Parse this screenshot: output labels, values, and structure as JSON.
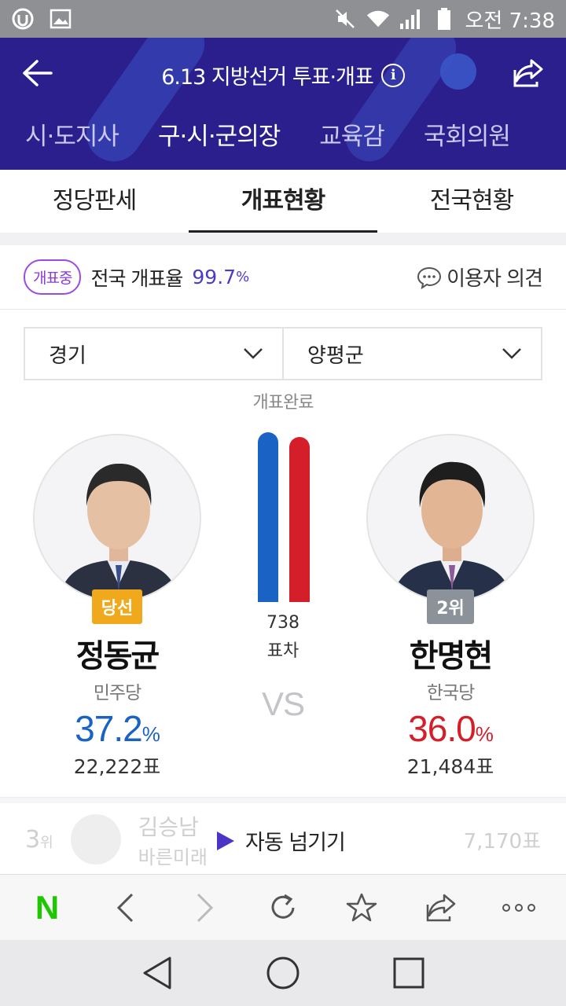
{
  "status_bar": {
    "time": "오전 7:38"
  },
  "header": {
    "title": "6.13 지방선거 투표·개표",
    "category_tabs": [
      {
        "label": "시·도지사",
        "active": false
      },
      {
        "label": "구·시·군의장",
        "active": true
      },
      {
        "label": "교육감",
        "active": false
      },
      {
        "label": "국회의원",
        "active": false
      }
    ]
  },
  "sub_tabs": [
    {
      "label": "정당판세",
      "active": false
    },
    {
      "label": "개표현황",
      "active": true
    },
    {
      "label": "전국현황",
      "active": false
    }
  ],
  "progress": {
    "badge": "개표중",
    "label": "전국 개표율",
    "value": "99.7",
    "unit": "%",
    "feedback_label": "이용자 의견"
  },
  "selectors": {
    "region": "경기",
    "district": "양평군"
  },
  "count_status": "개표완료",
  "candidates": [
    {
      "rank_label": "당선",
      "name": "정동균",
      "party": "민주당",
      "pct": "37.2",
      "pct_unit": "%",
      "votes": "22,222표",
      "color": "#1a63c4"
    },
    {
      "rank_label": "2위",
      "name": "한명현",
      "party": "한국당",
      "pct": "36.0",
      "pct_unit": "%",
      "votes": "21,484표",
      "color": "#d41f2a"
    }
  ],
  "bar_fraction": {
    "first": 1.0,
    "second": 0.97
  },
  "vote_gap": {
    "value": "738",
    "label": "표차"
  },
  "vs_label": "VS",
  "third_place": {
    "rank": "3",
    "rank_unit": "위",
    "name": "김승남",
    "party": "바른미래",
    "pct_fragment": "%",
    "votes": "7,170표"
  },
  "auto_next_label": "자동 넘기기",
  "browser_bar": {
    "logo": "N"
  }
}
